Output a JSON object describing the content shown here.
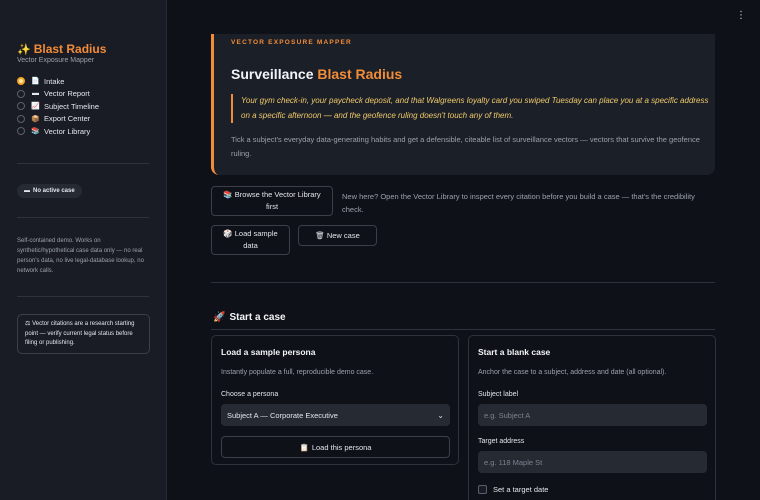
{
  "sidebar": {
    "brand_icon": "✨",
    "brand": "Blast Radius",
    "subtitle": "Vector Exposure Mapper",
    "nav": [
      {
        "icon": "📄",
        "label": "Intake",
        "selected": true
      },
      {
        "icon": "▬",
        "label": "Vector Report",
        "selected": false
      },
      {
        "icon": "📈",
        "label": "Subject Timeline",
        "selected": false
      },
      {
        "icon": "📦",
        "label": "Export Center",
        "selected": false
      },
      {
        "icon": "📚",
        "label": "Vector Library",
        "selected": false
      }
    ],
    "case_pill_icon": "▬",
    "case_pill": "No active case",
    "demo_note": "Self-contained demo. Works on synthetic/hypothetical case data only — no real person's data, no live legal-database lookup, no network calls.",
    "warning_icon": "⚖",
    "warning": "Vector citations are a research starting point — verify current legal status before filing or publishing."
  },
  "menu_icon": "⋮",
  "hero": {
    "eyebrow": "VECTOR EXPOSURE MAPPER",
    "title_plain": "Surveillance",
    "title_accent": "Blast Radius",
    "quote": "Your gym check-in, your paycheck deposit, and that Walgreens loyalty card you swiped Tuesday can place you at a specific address on a specific afternoon — and the geofence ruling doesn't touch any of them.",
    "description": "Tick a subject's everyday data-generating habits and get a defensible, citeable list of surveillance vectors — vectors that survive the geofence ruling."
  },
  "actions": {
    "browse_icon": "📚",
    "browse": "Browse the Vector Library first",
    "helper": "New here? Open the Vector Library to inspect every citation before you build a case — that's the credibility check.",
    "sample_icon": "🎲",
    "sample": "Load sample data",
    "new_icon": "🗑",
    "new": "New case"
  },
  "start": {
    "icon": "🚀",
    "title": "Start a case"
  },
  "persona_card": {
    "title": "Load a sample persona",
    "text": "Instantly populate a full, reproducible demo case.",
    "label": "Choose a persona",
    "selected": "Subject A — Corporate Executive",
    "chevron": "⌄",
    "load_icon": "📋",
    "load": "Load this persona"
  },
  "blank_card": {
    "title": "Start a blank case",
    "text": "Anchor the case to a subject, address and date (all optional).",
    "subject_label": "Subject label",
    "subject_placeholder": "e.g. Subject A",
    "address_label": "Target address",
    "address_placeholder": "e.g. 118 Maple St",
    "date_checkbox": "Set a target date"
  },
  "colors": {
    "accent": "#f28c38",
    "quote": "#f0c96a",
    "background": "#0e1117",
    "sidebar": "#191c24"
  }
}
